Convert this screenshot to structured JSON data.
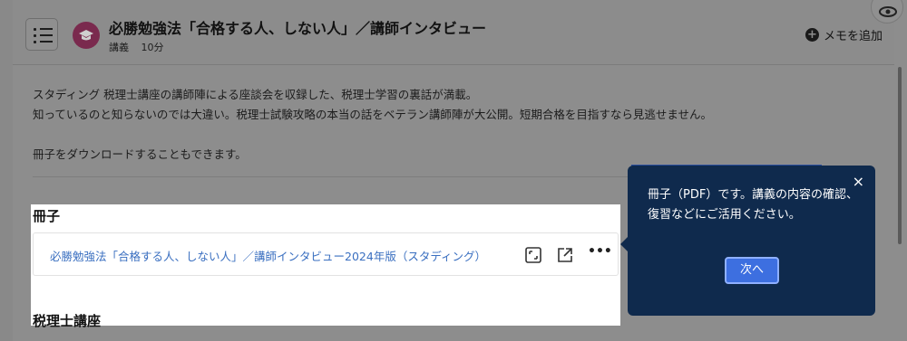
{
  "header": {
    "title": "必勝勉強法「合格する人、しない人」／講師インタビュー",
    "type_label": "講義",
    "duration": "10分",
    "memo_label": "メモを追加"
  },
  "description": {
    "line1": "スタディング 税理士講座の講師陣による座談会を収録した、税理士学習の裏話が満載。",
    "line2": "知っているのと知らないのでは大違い。税理士試験攻略の本当の話をベテラン講師陣が大公開。短期合格を目指すなら見逃せません。",
    "line3": "冊子をダウンロードすることもできます。"
  },
  "booklet": {
    "heading": "冊子",
    "file_name": "必勝勉強法「合格する人、しない人」／講師インタビュー2024年版（スタディング）",
    "more_label": "•••"
  },
  "course_section": {
    "heading": "税理士講座"
  },
  "tooltip": {
    "message": "冊子（PDF）です。講義の内容の確認、復習などにご活用ください。",
    "next_label": "次へ",
    "close_label": "×"
  },
  "colors": {
    "tooltip_bg": "#0f2a4d",
    "accent": "#3d6fe0",
    "link": "#3a6fc0"
  }
}
